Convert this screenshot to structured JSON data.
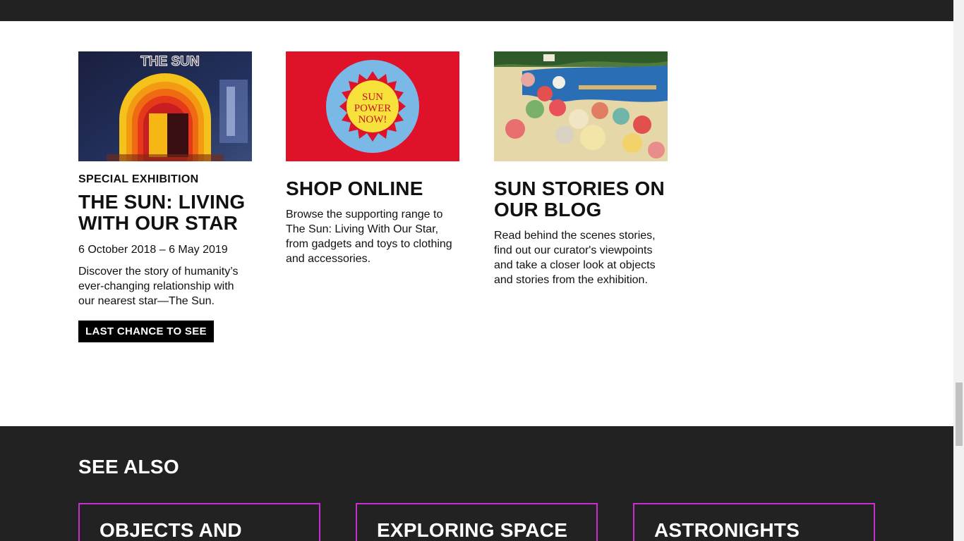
{
  "cards": [
    {
      "image_alt": "The Sun exhibition entrance arch",
      "image_text": "THE SUN",
      "kicker": "Special Exhibition",
      "title": "The Sun: Living With Our Star",
      "dates": "6 October 2018 – 6 May 2019",
      "description": "Discover the story of humanity’s ever-changing relationship with our nearest star—The Sun.",
      "cta": "Last chance to see"
    },
    {
      "image_alt": "Sun Power Now badge",
      "image_text_lines": [
        "SUN",
        "POWER",
        "NOW!"
      ],
      "title": "Shop online",
      "description": "Browse the supporting range to The Sun: Living With Our Star, from gadgets and toys to clothing and accessories."
    },
    {
      "image_alt": "Beach with parasols painting",
      "title": "Sun stories on our blog",
      "description": "Read behind the scenes stories, find out our curator's viewpoints and take a closer look at objects and stories from the exhibition."
    }
  ],
  "see_also": {
    "title": "See also",
    "tiles": [
      {
        "label": "Objects and"
      },
      {
        "label": "Exploring Space"
      },
      {
        "label": "Astronights"
      }
    ]
  },
  "colors": {
    "dark_band": "#222222",
    "tile_border": "#c62ed2",
    "cta_bg": "#000000"
  }
}
